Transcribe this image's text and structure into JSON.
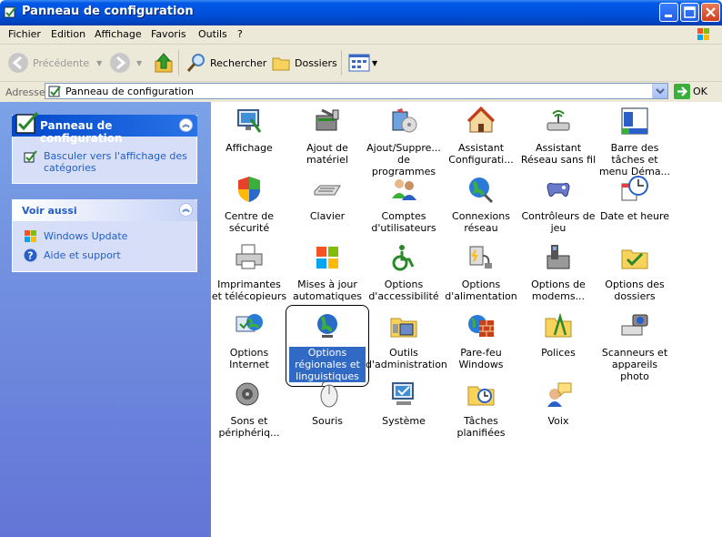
{
  "window": {
    "title": "Panneau de configuration"
  },
  "menu": [
    "Fichier",
    "Edition",
    "Affichage",
    "Favoris",
    "Outils",
    "?"
  ],
  "toolbar": {
    "back": "Précédente",
    "search": "Rechercher",
    "folders": "Dossiers"
  },
  "address": {
    "label": "Adresse",
    "value": "Panneau de configuration",
    "go": "OK"
  },
  "sidebar": {
    "panel1": {
      "title": "Panneau de configuration",
      "link": "Basculer vers l'affichage des catégories"
    },
    "panel2": {
      "title": "Voir aussi",
      "links": [
        "Windows Update",
        "Aide et support"
      ]
    }
  },
  "items": [
    [
      "Affichage",
      "Ajout de matériel",
      "Ajout/Suppre... de programmes",
      "Assistant Configurati...",
      "Assistant Réseau sans fil",
      "Barre des tâches et menu Déma..."
    ],
    [
      "Centre de sécurité",
      "Clavier",
      "Comptes d'utilisateurs",
      "Connexions réseau",
      "Contrôleurs de jeu",
      "Date et heure"
    ],
    [
      "Imprimantes et télécopieurs",
      "Mises à jour automatiques",
      "Options d'accessibilité",
      "Options d'alimentation",
      "Options de modems...",
      "Options des dossiers"
    ],
    [
      "Options Internet",
      "Options régionales et linguistiques",
      "Outils d'administration",
      "Pare-feu Windows",
      "Polices",
      "Scanneurs et appareils photo"
    ],
    [
      "Sons et périphériq...",
      "Souris",
      "Système",
      "Tâches planifiées",
      "Voix"
    ]
  ],
  "selected": "Options régionales et linguistiques",
  "colors": {
    "title_bar": "#0053e0",
    "sidebar": "#7ba2e7",
    "selection": "#316ac5",
    "link": "#215dc6"
  }
}
